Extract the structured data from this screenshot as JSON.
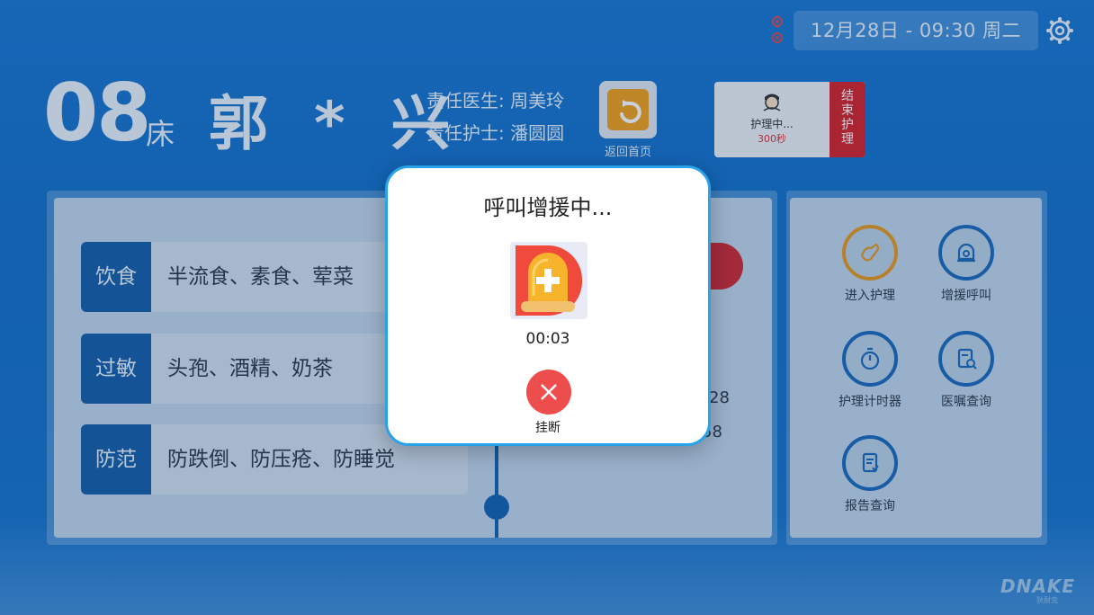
{
  "status": {
    "datetime": "12月28日 - 09:30  周二"
  },
  "patient": {
    "bed_number": "08",
    "bed_unit": "床",
    "name": "郭 * 兴",
    "doctor": "责任医生: 周美玲",
    "nurse": "责任护士: 潘圆圆"
  },
  "home_button": {
    "label": "返回首页"
  },
  "care_card": {
    "status": "护理中...",
    "timer": "300秒",
    "end_chars": [
      "结",
      "束",
      "护",
      "理"
    ]
  },
  "info_rows": [
    {
      "tag": "饮食",
      "value": "半流食、素食、荤菜"
    },
    {
      "tag": "过敏",
      "value": "头孢、酒精、奶茶"
    },
    {
      "tag": "防范",
      "value": "防跌倒、防压疮、防睡觉"
    }
  ],
  "partial_times": {
    "a": "28",
    "b": "58"
  },
  "actions": [
    {
      "label": "进入护理",
      "icon": "hand-care-icon"
    },
    {
      "label": "增援呼叫",
      "icon": "alarm-bell-icon"
    },
    {
      "label": "护理计时器",
      "icon": "stopwatch-icon"
    },
    {
      "label": "医嘱查询",
      "icon": "document-search-icon"
    },
    {
      "label": "报告查询",
      "icon": "report-icon"
    }
  ],
  "brand": {
    "name": "DNAKE",
    "sub": "狄耐克"
  },
  "modal": {
    "title": "呼叫增援中...",
    "timer": "00:03",
    "hangup_label": "挂断"
  },
  "colors": {
    "primary": "#1565b4",
    "accent_red": "#d8252b",
    "modal_border": "#29a3e8",
    "hangup": "#ee4d4d"
  }
}
